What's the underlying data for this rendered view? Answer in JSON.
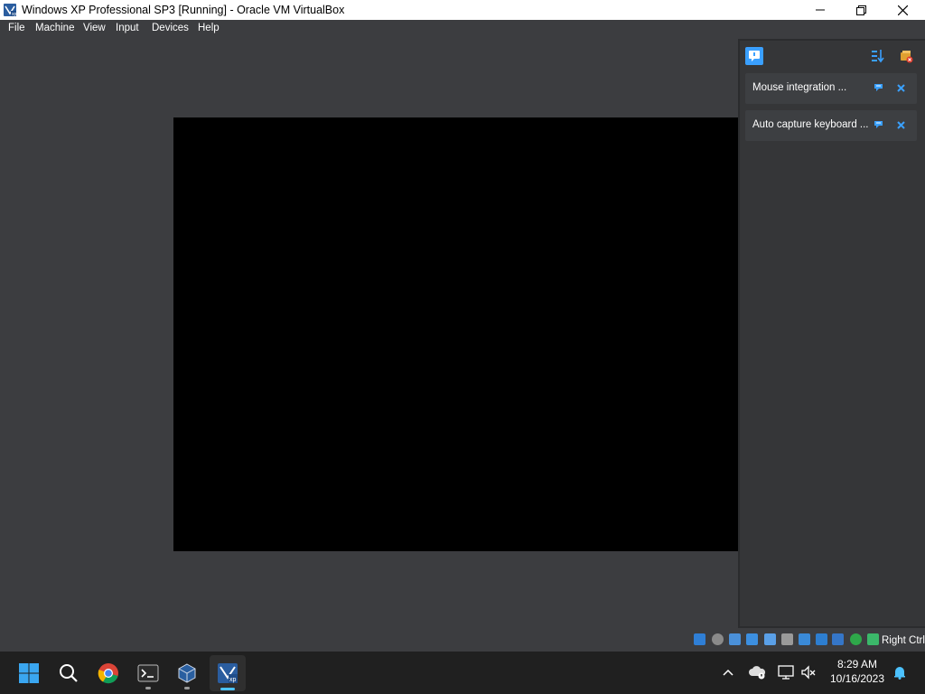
{
  "window": {
    "title": "Windows XP Professional SP3 [Running] - Oracle VM VirtualBox",
    "logo_icon": "virtualbox-xp-icon",
    "controls": [
      "minimize-icon",
      "maximize-icon",
      "close-icon"
    ]
  },
  "menu": {
    "items": [
      {
        "label": "File"
      },
      {
        "label": "Machine"
      },
      {
        "label": "View"
      },
      {
        "label": "Input"
      },
      {
        "label": "Devices"
      },
      {
        "label": "Help"
      }
    ]
  },
  "notification_center": {
    "toggle_icon": "notification-toggle-icon",
    "sort_icon": "sort-icon",
    "clear_icon": "clear-all-icon",
    "notifications": [
      {
        "text": "Mouse integration ...",
        "pin_icon": "keep-icon",
        "close_icon": "close-icon"
      },
      {
        "text": "Auto capture keyboard ...",
        "pin_icon": "keep-icon",
        "close_icon": "close-icon"
      }
    ]
  },
  "statusbar": {
    "icons": [
      "hard-disk-icon",
      "optical-drive-icon",
      "audio-icon",
      "network-icon",
      "usb-icon",
      "shared-folders-icon",
      "display-icon",
      "video-capture-icon",
      "cpu-icon",
      "virtualization-icon",
      "mouse-integration-icon",
      "keyboard-capture-icon"
    ],
    "host_key": "Right Ctrl"
  },
  "taskbar": {
    "apps": [
      {
        "name": "start-button",
        "icon": "windows-logo-icon"
      },
      {
        "name": "search-button",
        "icon": "search-icon"
      },
      {
        "name": "chrome-app",
        "icon": "chrome-icon"
      },
      {
        "name": "terminal-app",
        "icon": "terminal-icon"
      },
      {
        "name": "virtualbox-app",
        "icon": "virtualbox-icon"
      },
      {
        "name": "vm-window-app",
        "icon": "virtualbox-xp-icon"
      }
    ],
    "clock": {
      "time": "8:29 AM",
      "date": "10/16/2023"
    }
  },
  "colors": {
    "accent": "#4cc2ff",
    "background": "#3c3d40",
    "panel": "#353638",
    "taskbar": "#202020"
  }
}
